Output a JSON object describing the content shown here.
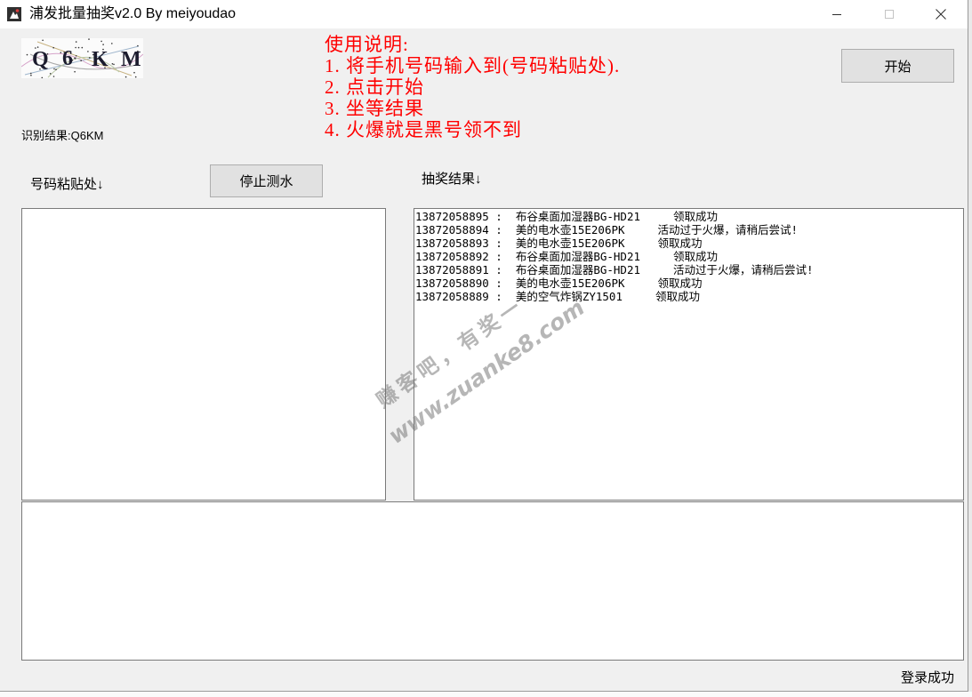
{
  "window": {
    "title": "浦发批量抽奖v2.0 By meiyoudao",
    "icon": "app-icon",
    "controls": [
      "minimize-icon",
      "maximize-icon",
      "close-icon"
    ]
  },
  "theme": {
    "instruction_color": "#ff0000",
    "window_background": "#f0f0f0",
    "button_background": "#e1e1e1"
  },
  "captcha": {
    "chars": [
      "Q",
      "6",
      "K",
      "M"
    ]
  },
  "recognition": {
    "label": "识别结果:",
    "value": "Q6KM"
  },
  "instructions": {
    "heading": "使用说明:",
    "steps": [
      "1. 将手机号码输入到(号码粘贴处).",
      "2. 点击开始",
      "3. 坐等结果",
      "4. 火爆就是黑号领不到"
    ]
  },
  "buttons": {
    "start": "开始",
    "stop": "停止测水"
  },
  "paste_area": {
    "label": "号码粘贴处↓"
  },
  "results": {
    "label": "抽奖结果↓",
    "separator": ":",
    "rows": [
      {
        "phone": "13872058895",
        "product": "布谷桌面加湿器BG-HD21",
        "status": "领取成功"
      },
      {
        "phone": "13872058894",
        "product": "美的电水壶15E206PK",
        "status": "活动过于火爆，请稍后尝试!"
      },
      {
        "phone": "13872058893",
        "product": "美的电水壶15E206PK",
        "status": "领取成功"
      },
      {
        "phone": "13872058892",
        "product": "布谷桌面加湿器BG-HD21",
        "status": "领取成功"
      },
      {
        "phone": "13872058891",
        "product": "布谷桌面加湿器BG-HD21",
        "status": "活动过于火爆，请稍后尝试!"
      },
      {
        "phone": "13872058890",
        "product": "美的电水壶15E206PK",
        "status": "领取成功"
      },
      {
        "phone": "13872058889",
        "product": "美的空气炸锅ZY1501",
        "status": "领取成功"
      }
    ]
  },
  "status_bar": {
    "text": "登录成功"
  },
  "watermark": {
    "line1": "赚客吧，有奖一",
    "line2": "www.zuanke8.com"
  }
}
